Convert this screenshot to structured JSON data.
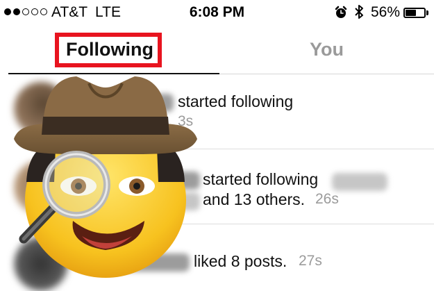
{
  "status_bar": {
    "signal_dots": [
      true,
      true,
      false,
      false,
      false
    ],
    "carrier": "AT&T",
    "network": "LTE",
    "time": "6:08 PM",
    "battery_percent": "56%",
    "battery_level": 0.56,
    "icons": [
      "alarm-icon",
      "bluetooth-icon",
      "battery-icon"
    ]
  },
  "tabs": {
    "following": "Following",
    "you": "You",
    "active": "following",
    "highlight_color": "#e8141f"
  },
  "feed": [
    {
      "action": "started following",
      "time": "3s"
    },
    {
      "action": "started following",
      "extra": "and 13 others.",
      "time": "26s"
    },
    {
      "action": "liked 8 posts.",
      "time": "27s"
    }
  ],
  "overlay": {
    "icon": "detective-emoji",
    "icon_secondary": "magnifying-glass-icon"
  },
  "colors": {
    "accent": "#e8141f",
    "muted_text": "#9b9b9b"
  }
}
